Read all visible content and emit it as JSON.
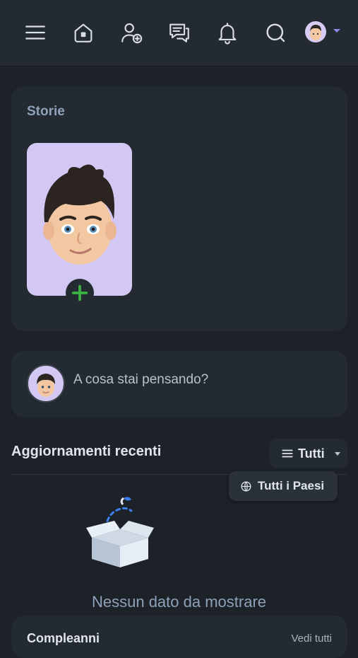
{
  "nav": {
    "icons": [
      "menu-icon",
      "home-icon",
      "add-friend-icon",
      "chat-icon",
      "bell-icon",
      "search-icon"
    ],
    "colors": {
      "bar": "#232a31",
      "icon": "#d9dee3",
      "caret": "#8a8cf0"
    }
  },
  "stories": {
    "title": "Storie",
    "add_symbol": "+",
    "add_color": "#3cb043"
  },
  "composer": {
    "placeholder": "A cosa stai pensando?"
  },
  "updates": {
    "title": "Aggiornamenti recenti",
    "filter_label": "Tutti",
    "country_label": "Tutti i Paesi",
    "empty_text": "Nessun dato da mostrare"
  },
  "bottom": {
    "left_label": "Compleanni",
    "right_label": "Vedi tutti"
  }
}
